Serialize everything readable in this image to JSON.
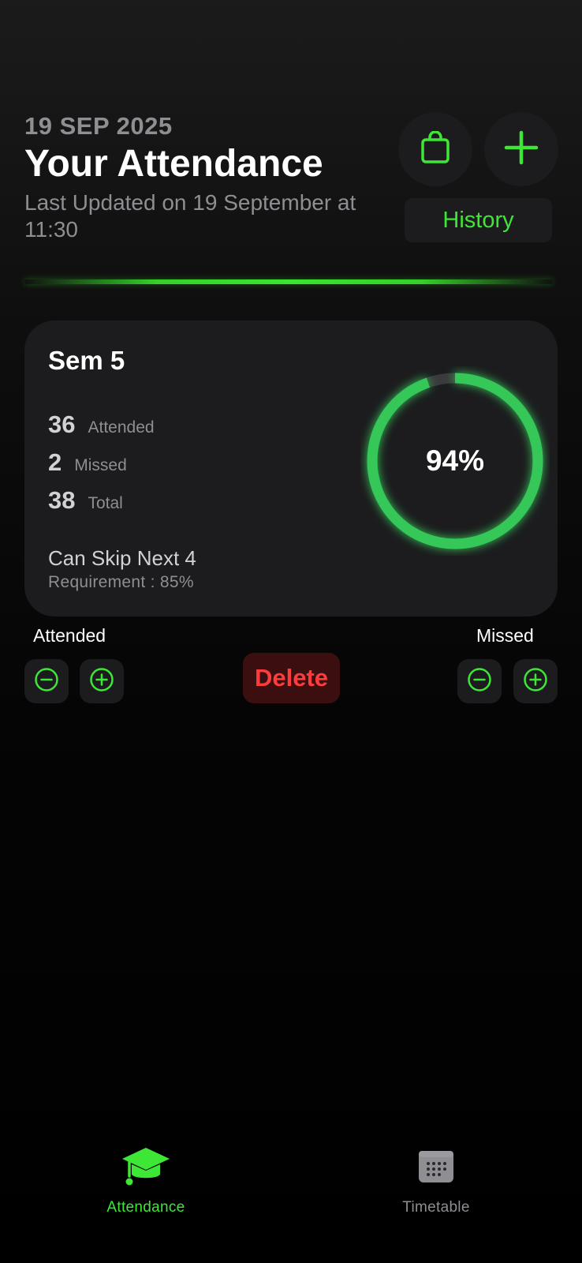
{
  "header": {
    "date": "19 SEP 2025",
    "title": "Your Attendance",
    "last_updated": "Last Updated on 19 September at 11:30",
    "history_label": "History",
    "bag_icon": "shopping-bag-icon",
    "plus_icon": "plus-icon"
  },
  "card": {
    "title": "Sem 5",
    "stats": [
      {
        "value": "36",
        "label": "Attended"
      },
      {
        "value": "2",
        "label": "Missed"
      },
      {
        "value": "38",
        "label": "Total"
      }
    ],
    "skip_text": "Can Skip Next 4",
    "requirement": "Requirement : 85%",
    "percent_text": "94%",
    "percent_value": 0.947
  },
  "controls": {
    "attended_label": "Attended",
    "missed_label": "Missed",
    "delete_label": "Delete"
  },
  "tabs": [
    {
      "label": "Attendance",
      "icon": "graduation-cap-icon",
      "active": true
    },
    {
      "label": "Timetable",
      "icon": "calendar-icon",
      "active": false
    }
  ],
  "colors": {
    "accent": "#3ee636",
    "ring": "#34c759",
    "danger": "#ff3b3b",
    "card_bg": "#1c1c1e",
    "muted": "#8e8e93"
  }
}
